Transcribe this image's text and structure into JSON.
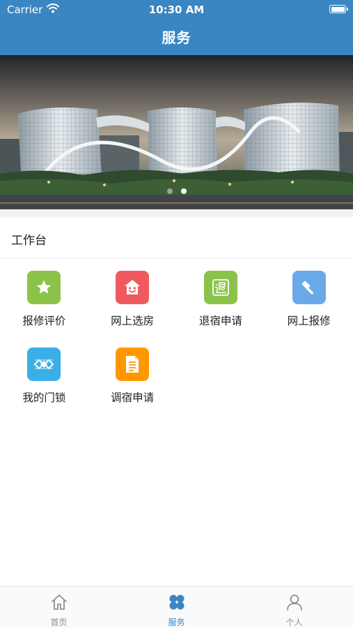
{
  "status_bar": {
    "carrier": "Carrier",
    "time": "10:30 AM",
    "wifi_icon": "wifi-icon",
    "battery_icon": "battery-icon",
    "battery_level": 1.0
  },
  "header": {
    "title": "服务",
    "color": "#3a86c2"
  },
  "banner": {
    "image": "building-photo",
    "page_count": 2,
    "active_page": 2
  },
  "workbench": {
    "title": "工作台",
    "items": [
      {
        "label": "报修评价",
        "icon": "star-icon",
        "color": "#8bc34a"
      },
      {
        "label": "网上选房",
        "icon": "house-face-icon",
        "color": "#ef5a5f"
      },
      {
        "label": "退宿申请",
        "icon": "tui-character-icon",
        "color": "#8bc34a"
      },
      {
        "label": "网上报修",
        "icon": "hammer-icon",
        "color": "#6aa9e9"
      },
      {
        "label": "我的门锁",
        "icon": "lock-pattern-icon",
        "color": "#3aaee6"
      },
      {
        "label": "调宿申请",
        "icon": "document-icon",
        "color": "#ff9800"
      }
    ]
  },
  "tabbar": {
    "active_color": "#3a86c2",
    "inactive_color": "#8e8e93",
    "tabs": [
      {
        "label": "首页",
        "icon": "home-icon",
        "active": false
      },
      {
        "label": "服务",
        "icon": "services-grid-icon",
        "active": true
      },
      {
        "label": "个人",
        "icon": "person-icon",
        "active": false
      }
    ]
  }
}
